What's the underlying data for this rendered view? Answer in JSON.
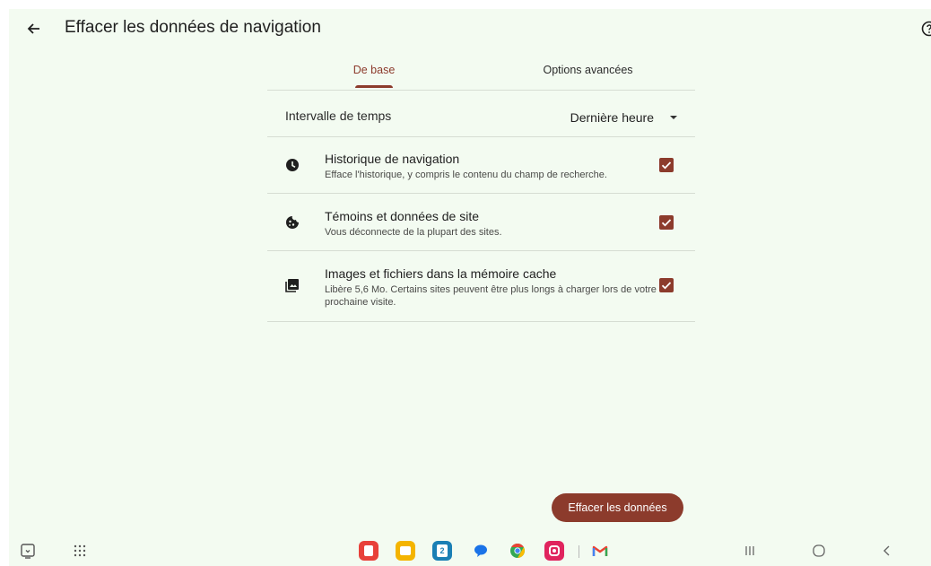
{
  "header": {
    "title": "Effacer les données de navigation",
    "back_icon": "arrow-left-icon",
    "help_icon": "help-icon"
  },
  "tabs": [
    {
      "label": "De base",
      "selected": true
    },
    {
      "label": "Options avancées",
      "selected": false
    }
  ],
  "time_range": {
    "label": "Intervalle de temps",
    "value": "Dernière heure"
  },
  "items": [
    {
      "icon": "clock-icon",
      "title": "Historique de navigation",
      "description": "Efface l'historique, y compris le contenu du champ de recherche.",
      "checked": true
    },
    {
      "icon": "cookie-icon",
      "title": "Témoins et données de site",
      "description": "Vous déconnecte de la plupart des sites.",
      "checked": true
    },
    {
      "icon": "image-stack-icon",
      "title": "Images et fichiers dans la mémoire cache",
      "description": "Libère 5,6 Mo. Certains sites peuvent être plus longs à charger lors de votre prochaine visite.",
      "checked": true
    }
  ],
  "clear_button": {
    "label": "Effacer les données"
  },
  "taskbar": {
    "apps": [
      {
        "name": "notes-app-icon",
        "color": "#e8413a"
      },
      {
        "name": "files-app-icon",
        "color": "#f4b400"
      },
      {
        "name": "calendar-app-icon",
        "color": "#1a7fb5",
        "label": "2"
      },
      {
        "name": "messages-app-icon",
        "color": "#1a73e8"
      },
      {
        "name": "chrome-app-icon",
        "color": "#34a853"
      },
      {
        "name": "screen-recorder-app-icon",
        "color": "#e0245e"
      },
      {
        "name": "gmail-app-icon",
        "color": "#ea4335"
      }
    ]
  },
  "colors": {
    "accent": "#8c3b2c",
    "background": "#f3fbf1"
  }
}
